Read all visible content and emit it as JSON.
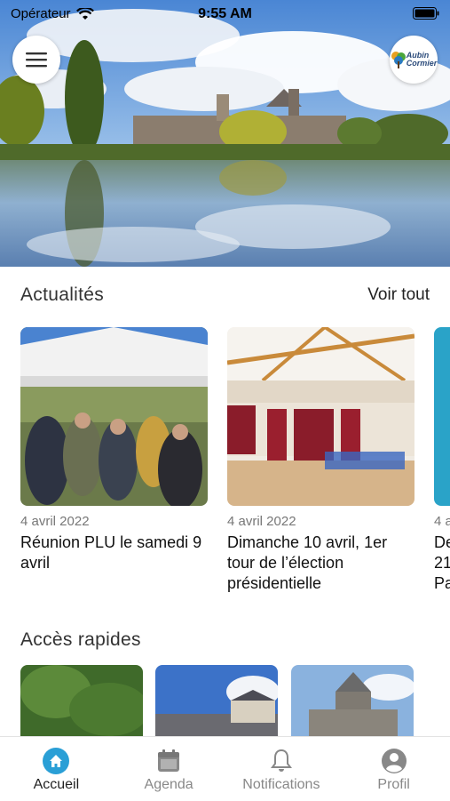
{
  "status_bar": {
    "carrier": "Opérateur",
    "time": "9:55 AM"
  },
  "header": {
    "menu_icon": "hamburger-icon",
    "logo_text_line1": "Aubin",
    "logo_text_line2": "Cormier"
  },
  "news": {
    "title": "Actualités",
    "see_all": "Voir tout",
    "items": [
      {
        "date": "4 avril 2022",
        "title": "Réunion PLU le samedi 9 avril"
      },
      {
        "date": "4 avril 2022",
        "title": "Dimanche 10 avril, 1er tour de l’élection présidentielle"
      },
      {
        "date": "4 a",
        "title": "De 21 Pa"
      }
    ]
  },
  "quick_access": {
    "title": "Accès rapides"
  },
  "tab_bar": {
    "items": [
      {
        "label": "Accueil",
        "icon": "home-icon",
        "active": true
      },
      {
        "label": "Agenda",
        "icon": "calendar-icon",
        "active": false
      },
      {
        "label": "Notifications",
        "icon": "bell-icon",
        "active": false
      },
      {
        "label": "Profil",
        "icon": "user-icon",
        "active": false
      }
    ]
  },
  "colors": {
    "accent": "#2a9fd6",
    "inactive": "#888888"
  }
}
